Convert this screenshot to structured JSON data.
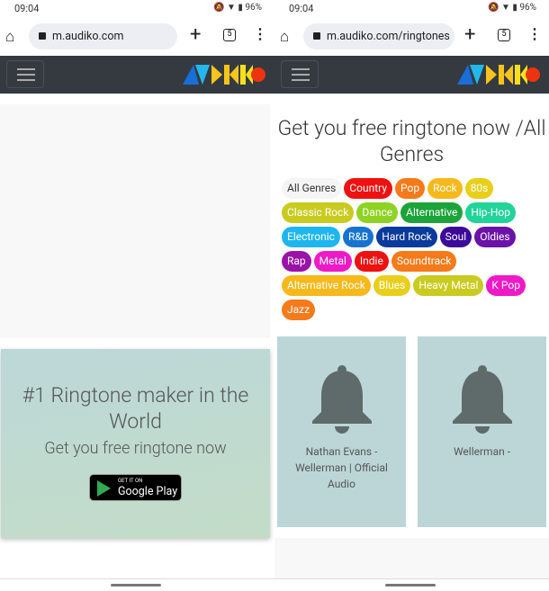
{
  "left": {
    "status": {
      "time": "09:04",
      "battery": "96%"
    },
    "browser": {
      "url": "m.audiko.com",
      "tab_count": "5"
    },
    "promo": {
      "headline": "#1 Ringtone maker in the World",
      "subtitle": "Get you free ringtone now",
      "badge_small": "GET IT ON",
      "badge_big": "Google Play"
    }
  },
  "right": {
    "status": {
      "time": "09:04",
      "battery": "96%"
    },
    "browser": {
      "url": "m.audiko.com/ringtones",
      "tab_count": "5"
    },
    "title": "Get you free ringtone now /All Genres",
    "genres": [
      {
        "label": "All Genres",
        "color": "#f5f5f5"
      },
      {
        "label": "Country",
        "color": "#ee1111"
      },
      {
        "label": "Pop",
        "color": "#f47a1a"
      },
      {
        "label": "Rock",
        "color": "#f6b91c"
      },
      {
        "label": "80s",
        "color": "#e8cf1c"
      },
      {
        "label": "Classic Rock",
        "color": "#c9cb20"
      },
      {
        "label": "Dance",
        "color": "#8ed323"
      },
      {
        "label": "Alternative",
        "color": "#1ca43a"
      },
      {
        "label": "Hip-Hop",
        "color": "#22d39a"
      },
      {
        "label": "Electronic",
        "color": "#1eb6ee"
      },
      {
        "label": "R&B",
        "color": "#1673d0"
      },
      {
        "label": "Hard Rock",
        "color": "#0a3a9c"
      },
      {
        "label": "Soul",
        "color": "#3b0a9a"
      },
      {
        "label": "Oldies",
        "color": "#6b12a8"
      },
      {
        "label": "Rap",
        "color": "#9b12a8"
      },
      {
        "label": "Metal",
        "color": "#ee1ac8"
      },
      {
        "label": "Indie",
        "color": "#ee1111"
      },
      {
        "label": "Soundtrack",
        "color": "#f47a1a"
      },
      {
        "label": "Alternative Rock",
        "color": "#f6b91c"
      },
      {
        "label": "Blues",
        "color": "#e8cf1c"
      },
      {
        "label": "Heavy Metal",
        "color": "#c9cb20"
      },
      {
        "label": "K Pop",
        "color": "#ee1ac8"
      },
      {
        "label": "Jazz",
        "color": "#f47a1a"
      }
    ],
    "cards": [
      {
        "title": "Nathan Evans - Wellerman | Official Audio"
      },
      {
        "title": "Wellerman -"
      }
    ]
  }
}
